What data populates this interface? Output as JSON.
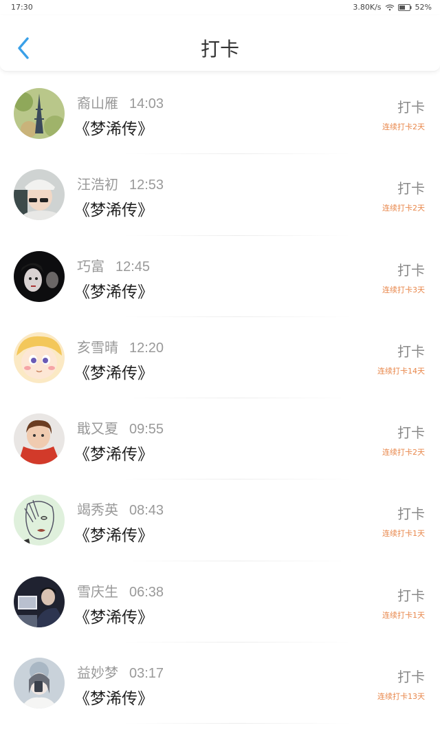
{
  "status_bar": {
    "time": "17:30",
    "speed": "3.80K/s",
    "battery": "52%"
  },
  "header": {
    "title": "打卡",
    "back_icon": "chevron-left-icon"
  },
  "colors": {
    "accent": "#3aa0e8",
    "streak": "#e8874b"
  },
  "records": [
    {
      "name": "裔山雁",
      "time": "14:03",
      "book": "《梦浠传》",
      "action": "打卡",
      "streak": "连续打卡2天",
      "avatar": "eiffel-tower-avatar"
    },
    {
      "name": "汪浩初",
      "time": "12:53",
      "book": "《梦浠传》",
      "action": "打卡",
      "streak": "连续打卡2天",
      "avatar": "boy-sunglasses-avatar"
    },
    {
      "name": "巧富",
      "time": "12:45",
      "book": "《梦浠传》",
      "action": "打卡",
      "streak": "连续打卡3天",
      "avatar": "dark-faces-avatar"
    },
    {
      "name": "亥雪晴",
      "time": "12:20",
      "book": "《梦浠传》",
      "action": "打卡",
      "streak": "连续打卡14天",
      "avatar": "cartoon-girl-avatar"
    },
    {
      "name": "戢又夏",
      "time": "09:55",
      "book": "《梦浠传》",
      "action": "打卡",
      "streak": "连续打卡2天",
      "avatar": "child-red-jacket-avatar"
    },
    {
      "name": "竭秀英",
      "time": "08:43",
      "book": "《梦浠传》",
      "action": "打卡",
      "streak": "连续打卡1天",
      "avatar": "sketch-face-avatar"
    },
    {
      "name": "雪庆生",
      "time": "06:38",
      "book": "《梦浠传》",
      "action": "打卡",
      "streak": "连续打卡1天",
      "avatar": "dark-room-avatar"
    },
    {
      "name": "益妙梦",
      "time": "03:17",
      "book": "《梦浠传》",
      "action": "打卡",
      "streak": "连续打卡13天",
      "avatar": "mirror-selfie-avatar"
    }
  ]
}
